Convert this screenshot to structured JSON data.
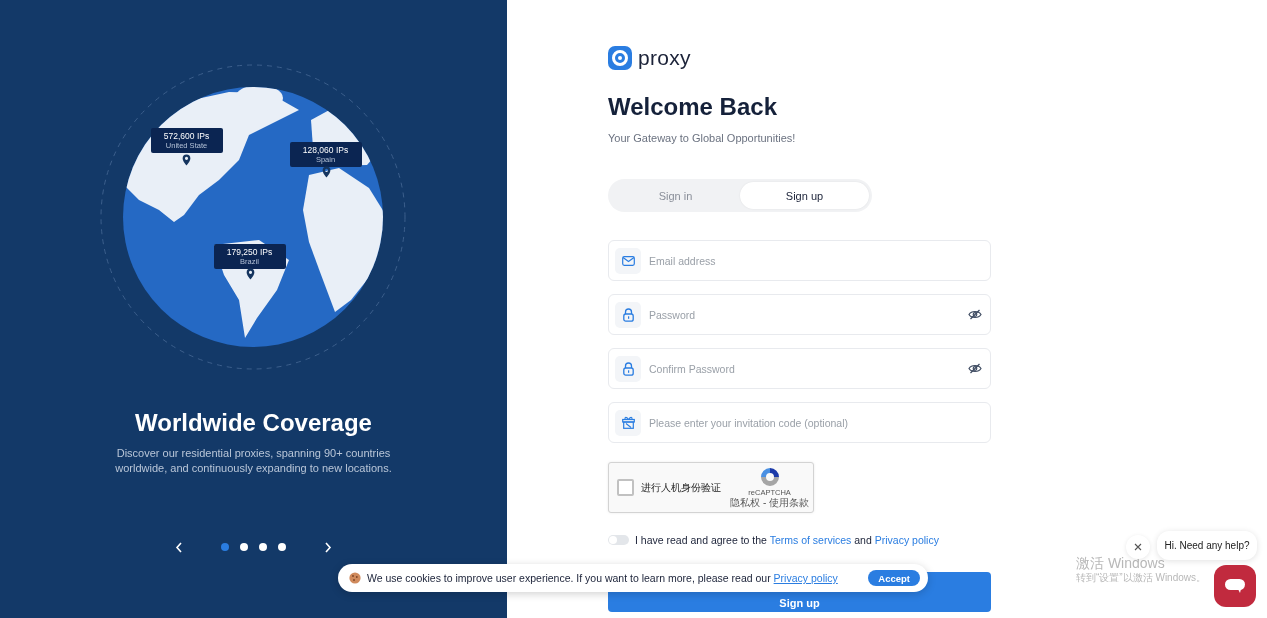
{
  "hero": {
    "markers": [
      {
        "count": "572,600 IPs",
        "country": "United State"
      },
      {
        "count": "128,060 IPs",
        "country": "Spain"
      },
      {
        "count": "179,250 IPs",
        "country": "Brazil"
      }
    ],
    "title": "Worldwide Coverage",
    "description": "Discover our residential proxies, spanning 90+ countries worldwide, and continuously expanding to new locations.",
    "dots": [
      {
        "selected": true
      },
      {
        "selected": false
      },
      {
        "selected": false
      },
      {
        "selected": false
      }
    ]
  },
  "brand": {
    "name": "proxy"
  },
  "heading": "Welcome Back",
  "subheading": "Your Gateway to Global Opportunities!",
  "tabs": [
    {
      "label": "Sign in",
      "selected": false
    },
    {
      "label": "Sign up",
      "selected": true
    }
  ],
  "fields": [
    {
      "kind": "email",
      "placeholder": "Email address"
    },
    {
      "kind": "password",
      "placeholder": "Password"
    },
    {
      "kind": "password",
      "placeholder": "Confirm Password"
    },
    {
      "kind": "invite",
      "placeholder": "Please enter your invitation code (optional)"
    }
  ],
  "captcha": {
    "checked": false,
    "label": "进行人机身份验证",
    "brand": "reCAPTCHA",
    "links": "隐私权 - 使用条款"
  },
  "agreement": {
    "on": false,
    "text": "I have read and agree to the",
    "terms_link": "Terms of services",
    "joiner": "and",
    "privacy_link": "Privacy policy"
  },
  "submit": "Sign up",
  "cookie_banner": {
    "text": "We use cookies to improve user experience. If you want to learn more, please read our",
    "link": "Privacy policy",
    "accept": "Accept"
  },
  "chat": {
    "greeting": "Hi. Need any help?"
  },
  "os_watermark": {
    "title": "激活 Windows",
    "hint": "转到“设置”以激活 Windows。"
  }
}
